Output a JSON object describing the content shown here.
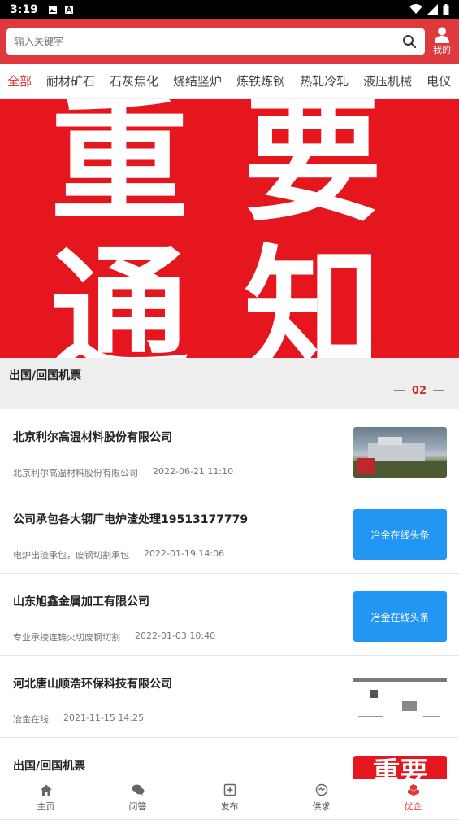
{
  "status_bar": {
    "time": "3:19"
  },
  "search": {
    "placeholder": "输入关键字"
  },
  "header": {
    "my_label": "我的"
  },
  "categories": [
    "全部",
    "耐材矿石",
    "石灰焦化",
    "烧结竖炉",
    "炼铁炼钢",
    "热轧冷轧",
    "液压机械",
    "电仪"
  ],
  "banner": {
    "chars": [
      "重",
      "要",
      "通",
      "知"
    ],
    "caption": "出国/回国机票",
    "page": "02"
  },
  "news": [
    {
      "title": "北京利尔高温材料股份有限公司",
      "source": "北京利尔高温材料股份有限公司",
      "time": "2022-06-21 11:10",
      "thumb_type": "photo",
      "thumb_text": ""
    },
    {
      "title": "公司承包各大钢厂电炉渣处理19513177779",
      "source": "电炉出渣承包，废钢切割承包",
      "time": "2022-01-19 14:06",
      "thumb_type": "blue",
      "thumb_text": "冶金在线头条"
    },
    {
      "title": "山东旭鑫金属加工有限公司",
      "source": "专业承接连铸火切废钢切割",
      "time": "2022-01-03 10:40",
      "thumb_type": "blue",
      "thumb_text": "冶金在线头条"
    },
    {
      "title": "河北唐山顺浩环保科技有限公司",
      "source": "冶金在线",
      "time": "2021-11-15 14:25",
      "thumb_type": "doc",
      "thumb_text": ""
    },
    {
      "title": "出国/回国机票",
      "source": "",
      "time": "",
      "thumb_type": "red",
      "thumb_text": "重要"
    }
  ],
  "tabs": [
    {
      "label": "主页",
      "icon": "home-icon"
    },
    {
      "label": "问答",
      "icon": "chat-icon"
    },
    {
      "label": "发布",
      "icon": "add-icon"
    },
    {
      "label": "供求",
      "icon": "supply-icon"
    },
    {
      "label": "优企",
      "icon": "company-icon"
    }
  ],
  "colors": {
    "brand": "#e0393d",
    "banner": "#e5161d",
    "accent_blue": "#2196f3"
  }
}
